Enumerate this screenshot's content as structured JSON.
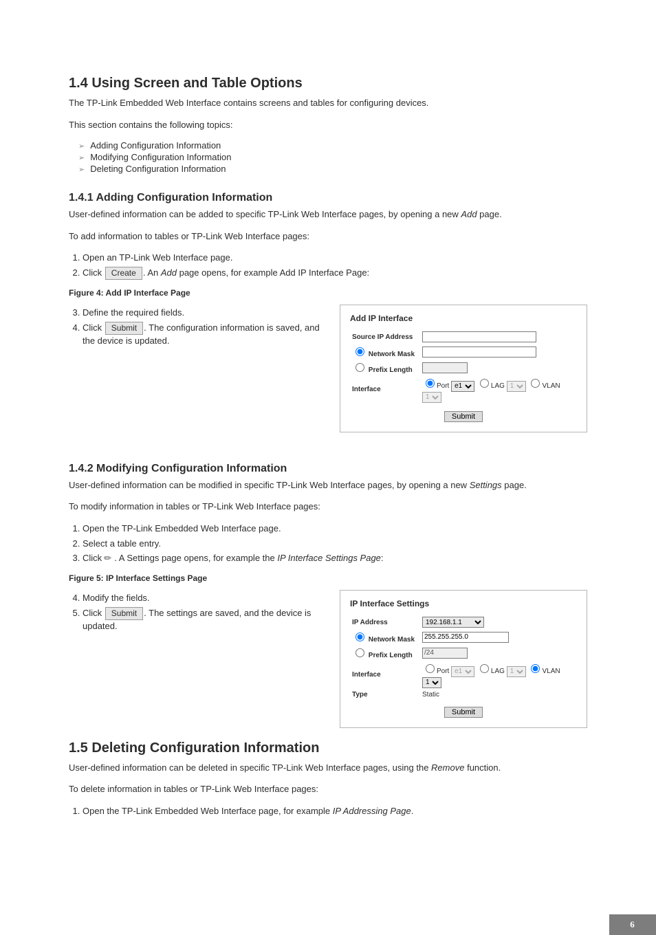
{
  "page_number": "6",
  "sec14": {
    "heading": "1.4   Using Screen and Table Options",
    "intro1": "The TP-Link Embedded Web Interface contains screens and tables for configuring devices.",
    "intro2": "This section contains the following topics:",
    "topics": [
      "Adding Configuration Information",
      "Modifying Configuration Information",
      "Deleting Configuration Information"
    ]
  },
  "sec141": {
    "heading": "1.4.1   Adding Configuration Information",
    "p1": "User-defined information can be added to specific TP-Link Web Interface pages, by opening a new ",
    "p1_em": "Add",
    "p1_tail": " page.",
    "p2": "To add information to tables or TP-Link Web Interface pages:",
    "step1": "Open an TP-Link Web Interface page.",
    "step2_a": "Click ",
    "step2_btn": "Create",
    "step2_b": ". An ",
    "step2_em": "Add",
    "step2_c": " page opens, for example Add IP Interface Page:",
    "figcap": "Figure 4: Add IP Interface Page",
    "step3": "Define the required fields.",
    "step4_a": "Click ",
    "step4_btn": "Submit",
    "step4_b": ". The configuration information is saved, and the device is updated."
  },
  "fig4": {
    "title": "Add IP Interface",
    "row_source": "Source IP Address",
    "row_mask": "Network Mask",
    "row_prefix": "Prefix Length",
    "row_interface": "Interface",
    "port": "Port",
    "port_val": "e1",
    "lag": "LAG",
    "lag_val": "1",
    "vlan": "VLAN",
    "vlan_val": "1",
    "submit": "Submit"
  },
  "sec142": {
    "heading": "1.4.2   Modifying Configuration Information",
    "p1_a": "User-defined information can be modified in specific TP-Link Web Interface pages, by opening a new ",
    "p1_em": "Settings",
    "p1_b": " page.",
    "p2": "To modify information in tables or TP-Link Web Interface pages:",
    "step1": "Open the TP-Link Embedded Web Interface page.",
    "step2": "Select a table entry.",
    "step3_a": "Click ",
    "step3_b": " . A Settings page opens, for example the ",
    "step3_em": "IP Interface Settings Page",
    "step3_c": ":",
    "figcap": "Figure 5: IP Interface Settings Page",
    "step4": "Modify the fields.",
    "step5_a": "Click ",
    "step5_btn": "Submit",
    "step5_b": ". The settings are saved, and the device is updated."
  },
  "fig5": {
    "title": "IP Interface Settings",
    "ip_label": "IP Address",
    "ip_value": "192.168.1.1",
    "mask_label": "Network Mask",
    "mask_value": "255.255.255.0",
    "prefix_label": "Prefix Length",
    "prefix_value": "/24",
    "interface_label": "Interface",
    "port": "Port",
    "port_val": "e1",
    "lag": "LAG",
    "lag_val": "1",
    "vlan": "VLAN",
    "vlan_val": "1",
    "type_label": "Type",
    "type_value": "Static",
    "submit": "Submit"
  },
  "sec15": {
    "heading": "1.5   Deleting Configuration Information",
    "p1_a": "User-defined information can be deleted in specific TP-Link Web Interface pages, using the ",
    "p1_em": "Remove",
    "p1_b": " function.",
    "p2": "To delete information in tables or TP-Link Web Interface pages:",
    "step1_a": "Open the TP-Link Embedded Web Interface page, for example ",
    "step1_em": "IP Addressing Page",
    "step1_b": "."
  }
}
